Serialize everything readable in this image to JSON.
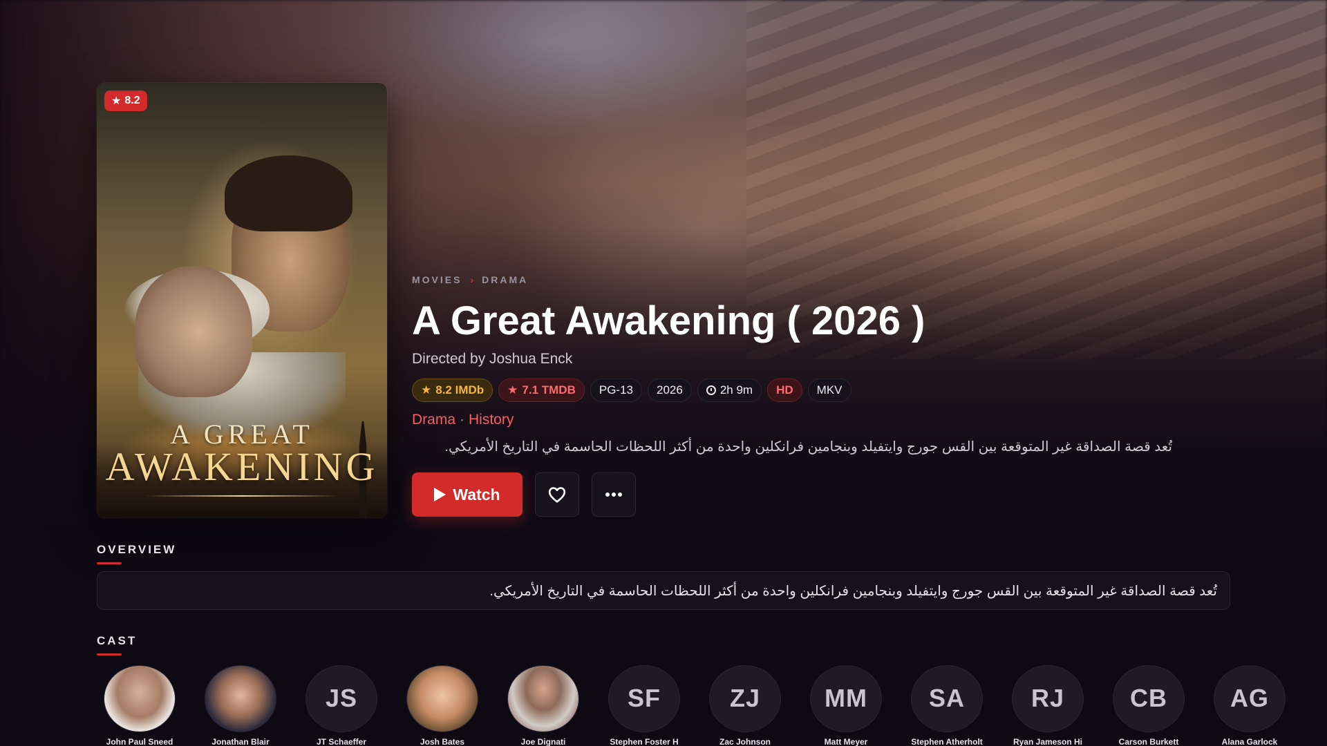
{
  "poster": {
    "rating_badge": "8.2",
    "art_title_line1": "A GREAT",
    "art_title_line2": "AWAKENING"
  },
  "breadcrumb": {
    "items": [
      "MOVIES",
      "DRAMA"
    ],
    "separator": "›"
  },
  "movie": {
    "title": "A Great Awakening ( 2026 )",
    "director_line": "Directed by Joshua Enck",
    "chips": {
      "imdb": "8.2 IMDb",
      "tmdb": "7.1 TMDB",
      "certification": "PG-13",
      "year": "2026",
      "runtime": "2h 9m",
      "quality": "HD",
      "container": "MKV"
    },
    "genres": [
      "Drama",
      "History"
    ],
    "genre_separator": "·",
    "tagline": "تُعد قصة الصداقة غير المتوقعة بين القس جورج وايتفيلد وبنجامين فرانكلين واحدة من أكثر اللحظات الحاسمة في التاريخ الأمريكي."
  },
  "actions": {
    "watch_label": "Watch",
    "favorite_icon": "heart-icon",
    "more_icon": "more-horizontal-icon"
  },
  "overview": {
    "label": "OVERVIEW",
    "text": "تُعد قصة الصداقة غير المتوقعة بين القس جورج وايتفيلد وبنجامين فرانكلين واحدة من أكثر اللحظات الحاسمة في التاريخ الأمريكي."
  },
  "cast": {
    "label": "CAST",
    "members": [
      {
        "initials": "",
        "name": "John Paul Sneed",
        "has_photo": true
      },
      {
        "initials": "",
        "name": "Jonathan Blair",
        "has_photo": true
      },
      {
        "initials": "JS",
        "name": "JT Schaeffer",
        "has_photo": false
      },
      {
        "initials": "",
        "name": "Josh Bates",
        "has_photo": true
      },
      {
        "initials": "",
        "name": "Joe Dignati",
        "has_photo": true
      },
      {
        "initials": "SF",
        "name": "Stephen Foster H",
        "has_photo": false
      },
      {
        "initials": "ZJ",
        "name": "Zac Johnson",
        "has_photo": false
      },
      {
        "initials": "MM",
        "name": "Matt Meyer",
        "has_photo": false
      },
      {
        "initials": "SA",
        "name": "Stephen Atherholt",
        "has_photo": false
      },
      {
        "initials": "RJ",
        "name": "Ryan Jameson Hi",
        "has_photo": false
      },
      {
        "initials": "CB",
        "name": "Carson Burkett",
        "has_photo": false
      },
      {
        "initials": "AG",
        "name": "Alana Garlock",
        "has_photo": false
      }
    ]
  },
  "colors": {
    "accent": "#d32b2b",
    "background": "#0e0a14",
    "imdb": "#f5b73a",
    "tmdb": "#ff6a70",
    "genre": "#ff5a66"
  }
}
